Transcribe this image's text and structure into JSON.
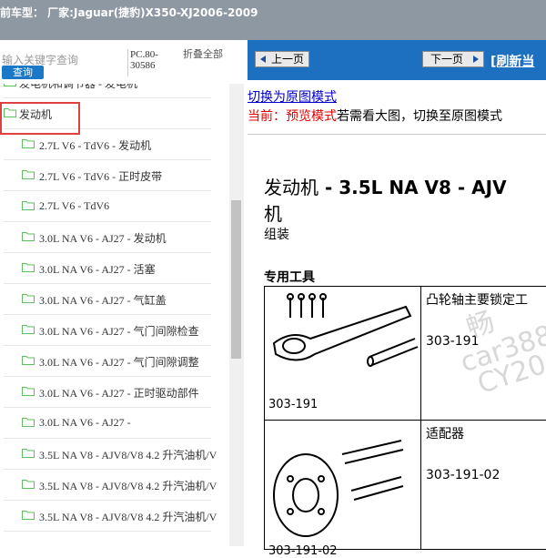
{
  "window": {
    "title": "前车型：  厂家:Jaguar(捷豹)X350-XJ2006-2009"
  },
  "search": {
    "placeholder": "输入关键字查询",
    "button_label": "查询",
    "pc_label": "PC.80-30586",
    "collapse_label": "折叠全部"
  },
  "tree": {
    "items": [
      {
        "label": "发电机和调节器 - 发电机"
      },
      {
        "label": "发动机"
      },
      {
        "label": "2.7L V6 - TdV6 - 发动机"
      },
      {
        "label": "2.7L V6 - TdV6 - 正时皮带"
      },
      {
        "label": "2.7L V6 - TdV6"
      },
      {
        "label": "3.0L NA V6 - AJ27 - 发动机"
      },
      {
        "label": "3.0L NA V6 - AJ27 - 活塞"
      },
      {
        "label": "3.0L NA V6 - AJ27 - 气缸盖"
      },
      {
        "label": "3.0L NA V6 - AJ27 - 气门间隙检查"
      },
      {
        "label": "3.0L NA V6 - AJ27 - 气门间隙调整"
      },
      {
        "label": "3.0L NA V6 - AJ27 - 正时驱动部件"
      },
      {
        "label": "3.0L NA V6 - AJ27 -"
      },
      {
        "label": "3.5L NA V8 - AJV8/V8 4.2 升汽油机/V"
      },
      {
        "label": "3.5L NA V8 - AJV8/V8 4.2 升汽油机/V"
      },
      {
        "label": "3.5L NA V8 - AJV8/V8 4.2 升汽油机/V"
      }
    ]
  },
  "nav": {
    "prev_label": "上一页",
    "next_label": "下一页",
    "refresh_label": "[刷新当"
  },
  "doc": {
    "switch_link": "切换为原图模式",
    "mode_current": "当前：",
    "mode_preview": "预览模式",
    "mode_hint": "若需看大图，切换至原图模式",
    "title_prefix": "发动机",
    "title_bold": " - 3.5L NA V8 - AJV",
    "title_line2": "机",
    "subtitle": "组装",
    "tools_heading": "专用工具",
    "tools": [
      {
        "name": "凸轮轴主要锁定工",
        "code": "303-191",
        "image_code": "303-191"
      },
      {
        "name": "适配器",
        "code": "303-191-02",
        "image_code": "303-191-02"
      }
    ],
    "watermark_lines": [
      "畅",
      "car388.c",
      "CY20"
    ]
  },
  "colors": {
    "nav_blue": "#1d6fc0",
    "folder_green": "#5cc05c",
    "highlight_red": "#e04040",
    "mode_red": "#e00000",
    "link_blue": "#0000cc"
  }
}
